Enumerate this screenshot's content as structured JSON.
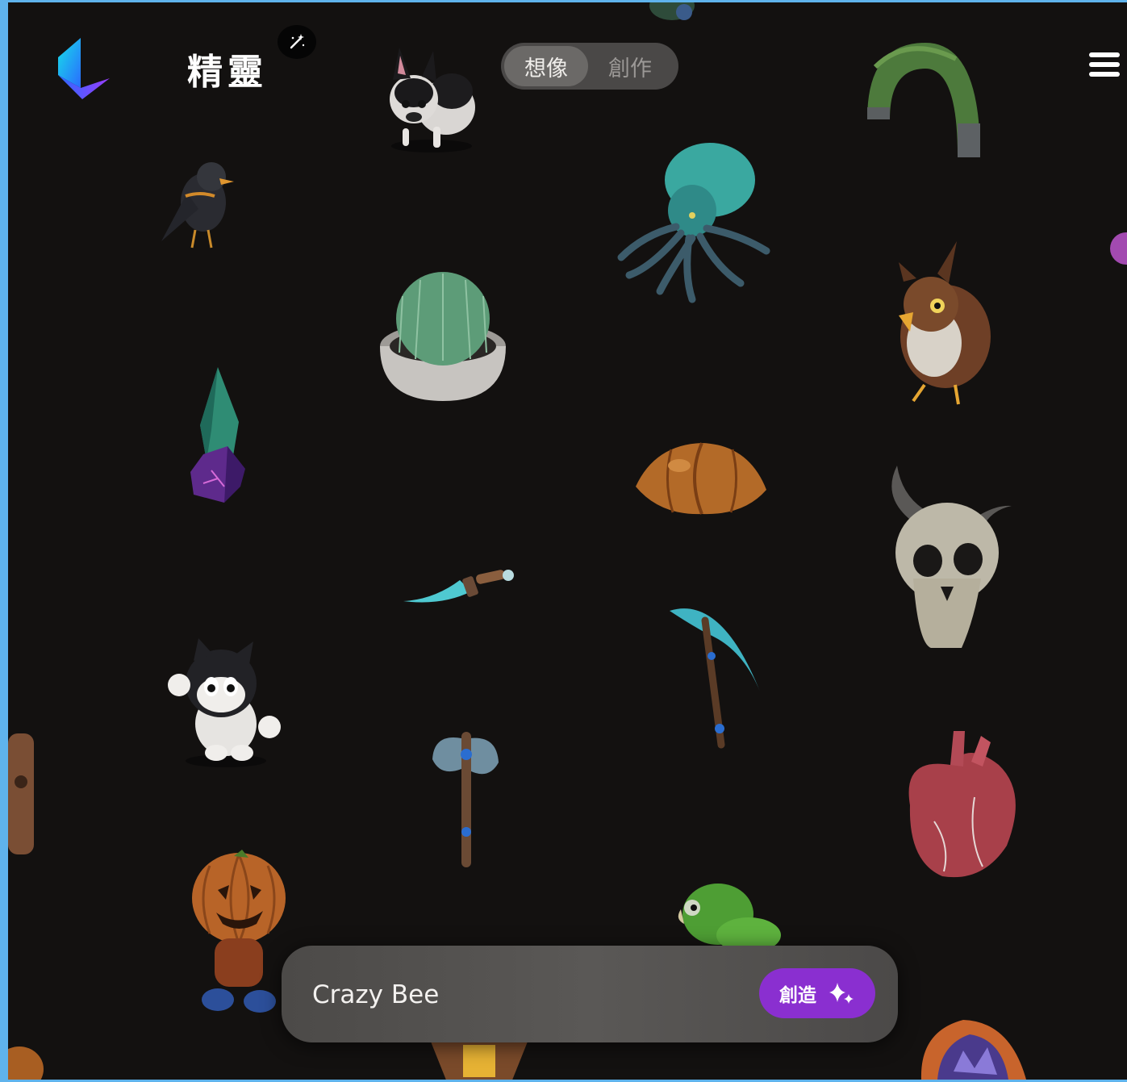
{
  "app": {
    "title": "精靈"
  },
  "mode_toggle": {
    "options": [
      "想像",
      "創作"
    ],
    "active_index": 0
  },
  "prompt": {
    "value": "Crazy Bee",
    "button_label": "創造"
  },
  "gallery": [
    {
      "name": "french-bulldog",
      "icon": "dog-model"
    },
    {
      "name": "stone-arch",
      "icon": "arch-model"
    },
    {
      "name": "dark-bird",
      "icon": "bird-model"
    },
    {
      "name": "octopus",
      "icon": "octopus-model"
    },
    {
      "name": "cactus-pot",
      "icon": "cactus-model"
    },
    {
      "name": "owl",
      "icon": "owl-model"
    },
    {
      "name": "crystal",
      "icon": "crystal-model"
    },
    {
      "name": "croissant",
      "icon": "croissant-model"
    },
    {
      "name": "horned-skull",
      "icon": "skull-model"
    },
    {
      "name": "dagger",
      "icon": "dagger-model"
    },
    {
      "name": "scythe",
      "icon": "scythe-model"
    },
    {
      "name": "cartoon-cat",
      "icon": "cat-model"
    },
    {
      "name": "battle-axe",
      "icon": "axe-model"
    },
    {
      "name": "anatomical-heart",
      "icon": "heart-model"
    },
    {
      "name": "pumpkin-head-figure",
      "icon": "pumpkin-model"
    },
    {
      "name": "green-parrot",
      "icon": "parrot-model"
    },
    {
      "name": "geode",
      "icon": "geode-model"
    }
  ],
  "colors": {
    "background": "#131110",
    "accent": "#8a2fd0",
    "frame": "#5fb3ec"
  }
}
